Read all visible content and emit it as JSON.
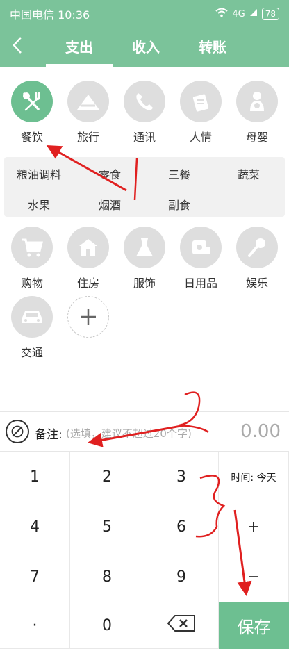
{
  "status_bar": {
    "carrier_time": "中国电信 10:36",
    "network": "4G",
    "battery": "78"
  },
  "nav": {
    "tabs": [
      {
        "label": "支出"
      },
      {
        "label": "收入"
      },
      {
        "label": "转账"
      }
    ]
  },
  "categories": [
    {
      "label": "餐饮",
      "icon": "utensils-icon"
    },
    {
      "label": "旅行",
      "icon": "tent-icon"
    },
    {
      "label": "通讯",
      "icon": "phone-icon"
    },
    {
      "label": "人情",
      "icon": "gift-envelope-icon"
    },
    {
      "label": "母婴",
      "icon": "baby-icon"
    },
    {
      "label": "购物",
      "icon": "cart-icon"
    },
    {
      "label": "住房",
      "icon": "house-icon"
    },
    {
      "label": "服饰",
      "icon": "dress-icon"
    },
    {
      "label": "日用品",
      "icon": "tissue-roll-icon"
    },
    {
      "label": "娱乐",
      "icon": "microphone-icon"
    },
    {
      "label": "交通",
      "icon": "car-icon"
    }
  ],
  "subcategories": [
    "粮油调料",
    "零食",
    "三餐",
    "蔬菜",
    "水果",
    "烟酒",
    "副食"
  ],
  "memo": {
    "label": "备注:",
    "placeholder": "(选填，建议不超过20个字)",
    "amount": "0.00"
  },
  "keypad": {
    "keys": [
      "1",
      "2",
      "3",
      "4",
      "5",
      "6",
      "7",
      "8",
      "9",
      "·",
      "0"
    ],
    "time_label": "时间: 今天",
    "plus": "+",
    "minus": "−",
    "save": "保存"
  },
  "colors": {
    "accent": "#7bc39a",
    "annotation": "#e02020"
  }
}
